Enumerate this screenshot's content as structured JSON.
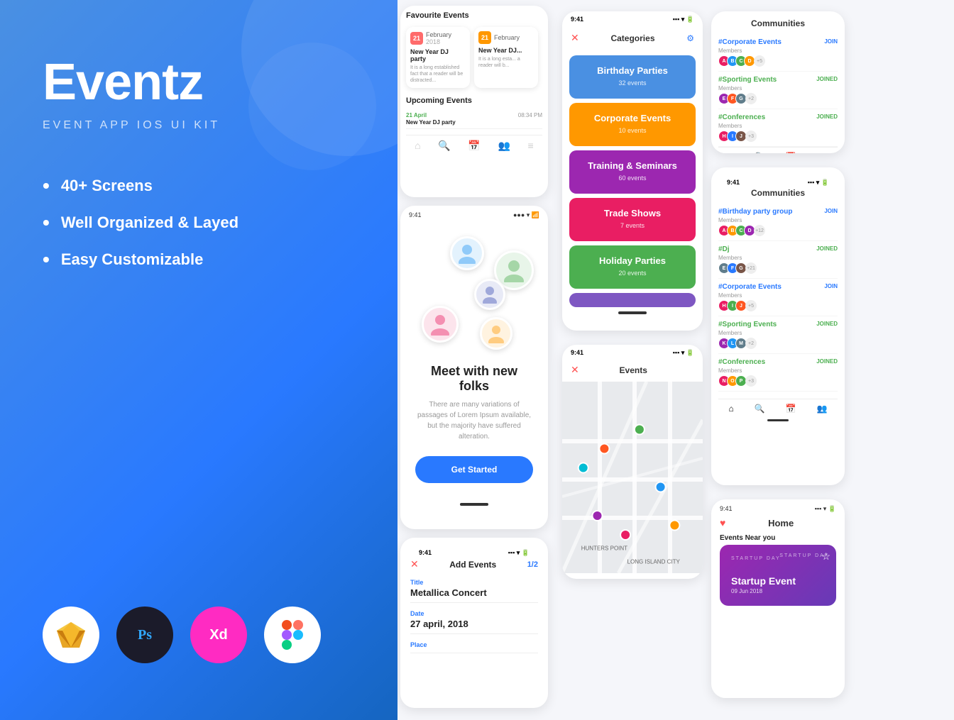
{
  "left": {
    "app_title": "Eventz",
    "app_subtitle": "EVENT APP IOS UI KIT",
    "features": [
      "40+ Screens",
      "Well Organized & Layed",
      "Easy Customizable"
    ],
    "tools": [
      "Sketch",
      "Ps",
      "Xd",
      "Figma"
    ]
  },
  "phone1": {
    "status_time": "9:41",
    "favourite_title": "Favourite Events",
    "card1": {
      "day": "21",
      "month": "February",
      "year": "2018",
      "title": "New Year DJ party",
      "desc": "It is a long established fact that a reader will be distracted..."
    },
    "card2": {
      "day": "21",
      "month": "February",
      "title": "New Year DJ...",
      "desc": "It is a long esta... a reader will b..."
    },
    "upcoming_title": "Upcoming Events",
    "upcoming": {
      "date": "21 April",
      "time": "08:34 PM",
      "name": "New Year DJ party"
    }
  },
  "phone2": {
    "status_time": "9:41",
    "headline": "Meet with new folks",
    "description": "There are many variations of passages of Lorem Ipsum available, but the majority have suffered alteration.",
    "cta": "Get Started"
  },
  "phone3": {
    "status_time": "9:41",
    "header_title": "Add Events",
    "step": "1/2",
    "title_label": "Title",
    "title_value": "Metallica Concert",
    "date_label": "Date",
    "date_value": "27 april, 2018",
    "place_label": "Place"
  },
  "phone_categories": {
    "status_time": "9:41",
    "title": "Categories",
    "categories": [
      {
        "name": "Birthday Parties",
        "count": "32 events",
        "color": "blue"
      },
      {
        "name": "Corporate Events",
        "count": "10 events",
        "color": "orange"
      },
      {
        "name": "Training & Seminars",
        "count": "60 events",
        "color": "purple"
      },
      {
        "name": "Trade Shows",
        "count": "7 events",
        "color": "pink"
      },
      {
        "name": "Holiday Parties",
        "count": "20 events",
        "color": "green"
      },
      {
        "name": "...",
        "count": "",
        "color": "violet"
      }
    ]
  },
  "phone_map": {
    "status_time": "9:41",
    "title": "Events"
  },
  "phone_communities1": {
    "title": "Communities",
    "items": [
      {
        "name": "#Corporate Events",
        "join": "JOIN",
        "joined": false
      },
      {
        "name": "#Sporting Events",
        "join": "JOINED",
        "joined": true
      },
      {
        "name": "#Conferences",
        "join": "JOINED",
        "joined": true
      }
    ]
  },
  "phone_communities2": {
    "status_time": "9:41",
    "title": "Communities",
    "items": [
      {
        "name": "#Birthday party group",
        "join": "JOIN",
        "joined": false
      },
      {
        "name": "#Dj",
        "join": "JOINED",
        "joined": true
      },
      {
        "name": "#Corporate Events",
        "join": "JOIN",
        "joined": false
      },
      {
        "name": "#Sporting Events",
        "join": "JOINED",
        "joined": true
      },
      {
        "name": "#Conferences",
        "join": "JOINED",
        "joined": true
      }
    ]
  },
  "phone_home": {
    "status_time": "9:41",
    "section_label": "Events Near you",
    "event_name": "Startup Event",
    "event_date": "09 Jun 2018",
    "watermark": "STARTUP DAY"
  }
}
